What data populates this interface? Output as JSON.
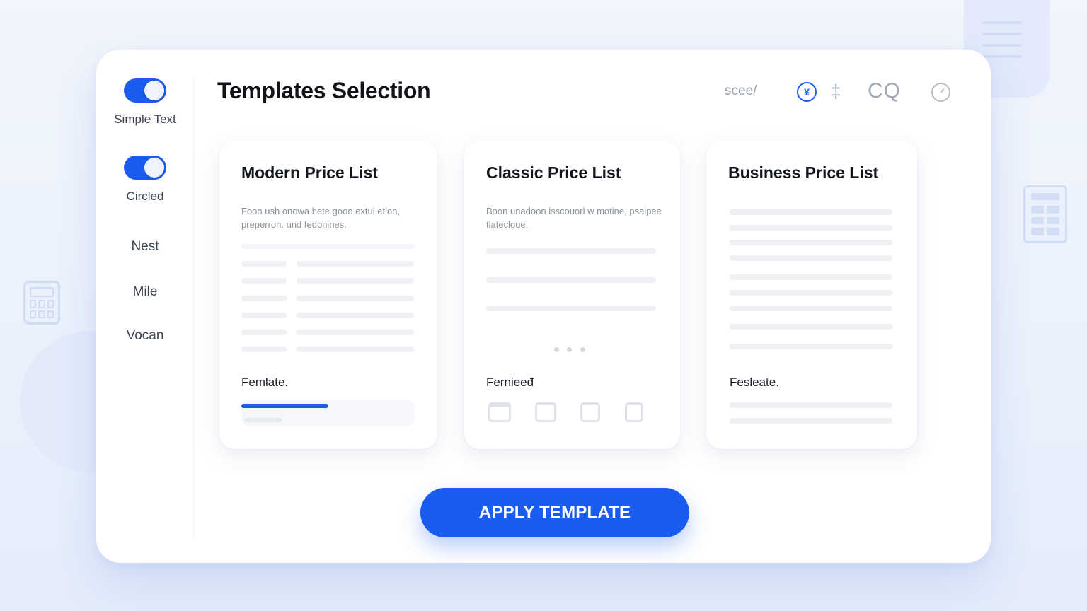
{
  "sidebar": {
    "toggles": [
      {
        "label": "Simple Text",
        "on": true
      },
      {
        "label": "Circled",
        "on": true
      }
    ],
    "items": [
      {
        "label": "Nest"
      },
      {
        "label": "Mile"
      },
      {
        "label": "Vocan"
      }
    ]
  },
  "header": {
    "title": "Templates Selection",
    "search_text": "scee/",
    "icons": [
      "yen-icon",
      "plus-icon",
      "cq-icon",
      "clock-icon"
    ],
    "yen_glyph": "¥",
    "plus_glyph": "‡",
    "cq_text": "CQ"
  },
  "cards": [
    {
      "title": "Modern Price List",
      "description": "Foon ush onowa hete goon extul etion, preperron. und fedonines.",
      "footer": "Femlate.",
      "progress": 0.5
    },
    {
      "title": "Classic Price List",
      "description": "Boon unadoon isscouorl w motine, psaipee tlatecloue.",
      "footer": "Fernieeđ",
      "icons": [
        "drawer-icon",
        "document-icon",
        "save-icon",
        "edit-icon"
      ]
    },
    {
      "title": "Business Price List",
      "description": "",
      "footer": "Fesleate."
    }
  ],
  "apply_button": "APPLY TEMPLATE",
  "colors": {
    "accent": "#1a5cf0",
    "background": "#eef3fc",
    "panel": "#ffffff"
  }
}
